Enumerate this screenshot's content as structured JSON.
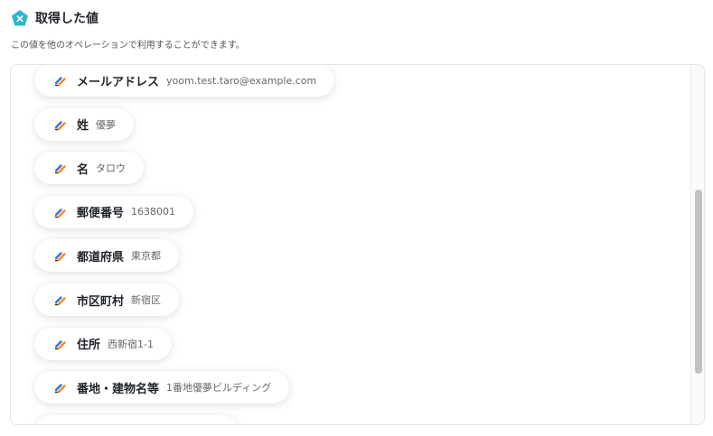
{
  "header": {
    "title": "取得した値",
    "description": "この値を他のオペレーションで利用することができます。"
  },
  "fields": [
    {
      "label": "メールアドレス",
      "value": "yoom.test.taro@example.com"
    },
    {
      "label": "姓",
      "value": "優夢"
    },
    {
      "label": "名",
      "value": "タロウ"
    },
    {
      "label": "郵便番号",
      "value": "1638001"
    },
    {
      "label": "都道府県",
      "value": "東京都"
    },
    {
      "label": "市区町村",
      "value": "新宿区"
    },
    {
      "label": "住所",
      "value": "西新宿1-1"
    },
    {
      "label": "番地・建物名等",
      "value": "1番地優夢ビルディング"
    },
    {
      "label": "",
      "value": ""
    }
  ],
  "icons": {
    "header_icon": "pentagon-x-icon",
    "field_icon": "pencil-icon"
  },
  "colors": {
    "accent": "#2cb4d4",
    "pencil_blue": "#3a6fd8",
    "pencil_orange": "#f08a24"
  }
}
